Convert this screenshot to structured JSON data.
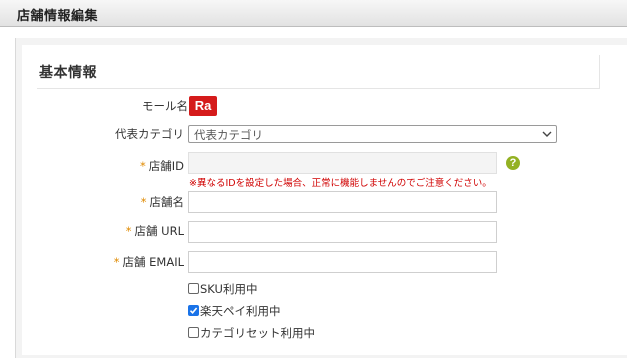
{
  "header": {
    "title": "店舗情報編集"
  },
  "section": {
    "title": "基本情報"
  },
  "form": {
    "mall": {
      "label": "モール名",
      "badge_text": "Ra",
      "badge_color": "#d51b1b"
    },
    "category": {
      "label": "代表カテゴリ",
      "selected": "代表カテゴリ"
    },
    "store_id": {
      "label": "店舗ID",
      "required": "*",
      "value": "",
      "help": "?",
      "warning": "※異なるIDを設定した場合、正常に機能しませんのでご注意ください。"
    },
    "store_name": {
      "label": "店舗名",
      "required": "*",
      "value": ""
    },
    "store_url": {
      "label": "店舗 URL",
      "required": "*",
      "value": ""
    },
    "store_email": {
      "label": "店舗 EMAIL",
      "required": "*",
      "value": ""
    }
  },
  "options": [
    {
      "label": "SKU利用中",
      "checked": false
    },
    {
      "label": "楽天ペイ利用中",
      "checked": true
    },
    {
      "label": "カテゴリセット利用中",
      "checked": false
    }
  ],
  "colors": {
    "required": "#e08a00",
    "warning": "#d00000",
    "help": "#93b123",
    "checkbox": "#1a73e8"
  }
}
